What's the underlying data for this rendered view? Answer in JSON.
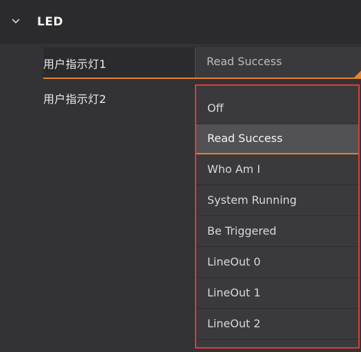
{
  "section": {
    "title": "LED",
    "chevron_icon": "chevron-down-icon"
  },
  "rows": [
    {
      "label": "用户指示灯1",
      "value": "Read Success"
    },
    {
      "label": "用户指示灯2",
      "value": ""
    }
  ],
  "dropdown": {
    "options": [
      "Off",
      "Read Success",
      "Who Am I",
      "System Running",
      "Be Triggered",
      "LineOut 0",
      "LineOut 1",
      "LineOut 2"
    ],
    "selected": "Read Success"
  },
  "colors": {
    "accent": "#e8832a",
    "highlight_border": "#e53935",
    "background": "#333335"
  }
}
